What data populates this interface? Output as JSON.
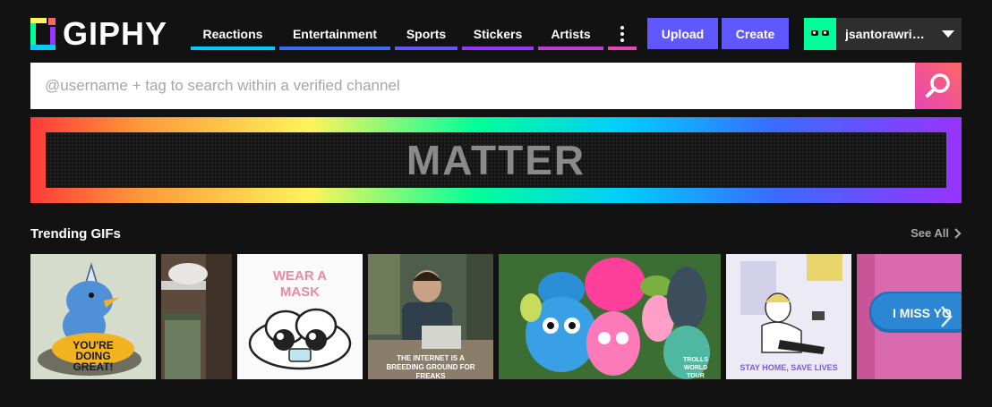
{
  "header": {
    "logo_text": "GIPHY",
    "nav": [
      {
        "label": "Reactions",
        "color": "#00ccff"
      },
      {
        "label": "Entertainment",
        "color": "#3a6bff"
      },
      {
        "label": "Sports",
        "color": "#6157ff"
      },
      {
        "label": "Stickers",
        "color": "#9933ff"
      },
      {
        "label": "Artists",
        "color": "#c13bd6"
      }
    ],
    "more_icon": "more-vertical-icon",
    "upload_label": "Upload",
    "create_label": "Create",
    "username": "jsantorawri…",
    "accent_color": "#6157ff"
  },
  "search": {
    "placeholder": "@username + tag to search within a verified channel",
    "value": "",
    "icon": "search-icon"
  },
  "banner": {
    "text": "MATTER"
  },
  "trending": {
    "title": "Trending GIFs",
    "see_all_label": "See All",
    "gifs": [
      {
        "caption": "YOU'RE DOING GREAT!"
      },
      {
        "caption": ""
      },
      {
        "caption": "WEAR A MASK"
      },
      {
        "caption": "THE INTERNET IS A BREEDING GROUND FOR FREAKS"
      },
      {
        "caption": "TROLLS WORLD TOUR"
      },
      {
        "caption": "STAY HOME, SAVE LIVES"
      },
      {
        "caption": "I MISS YO"
      }
    ]
  }
}
